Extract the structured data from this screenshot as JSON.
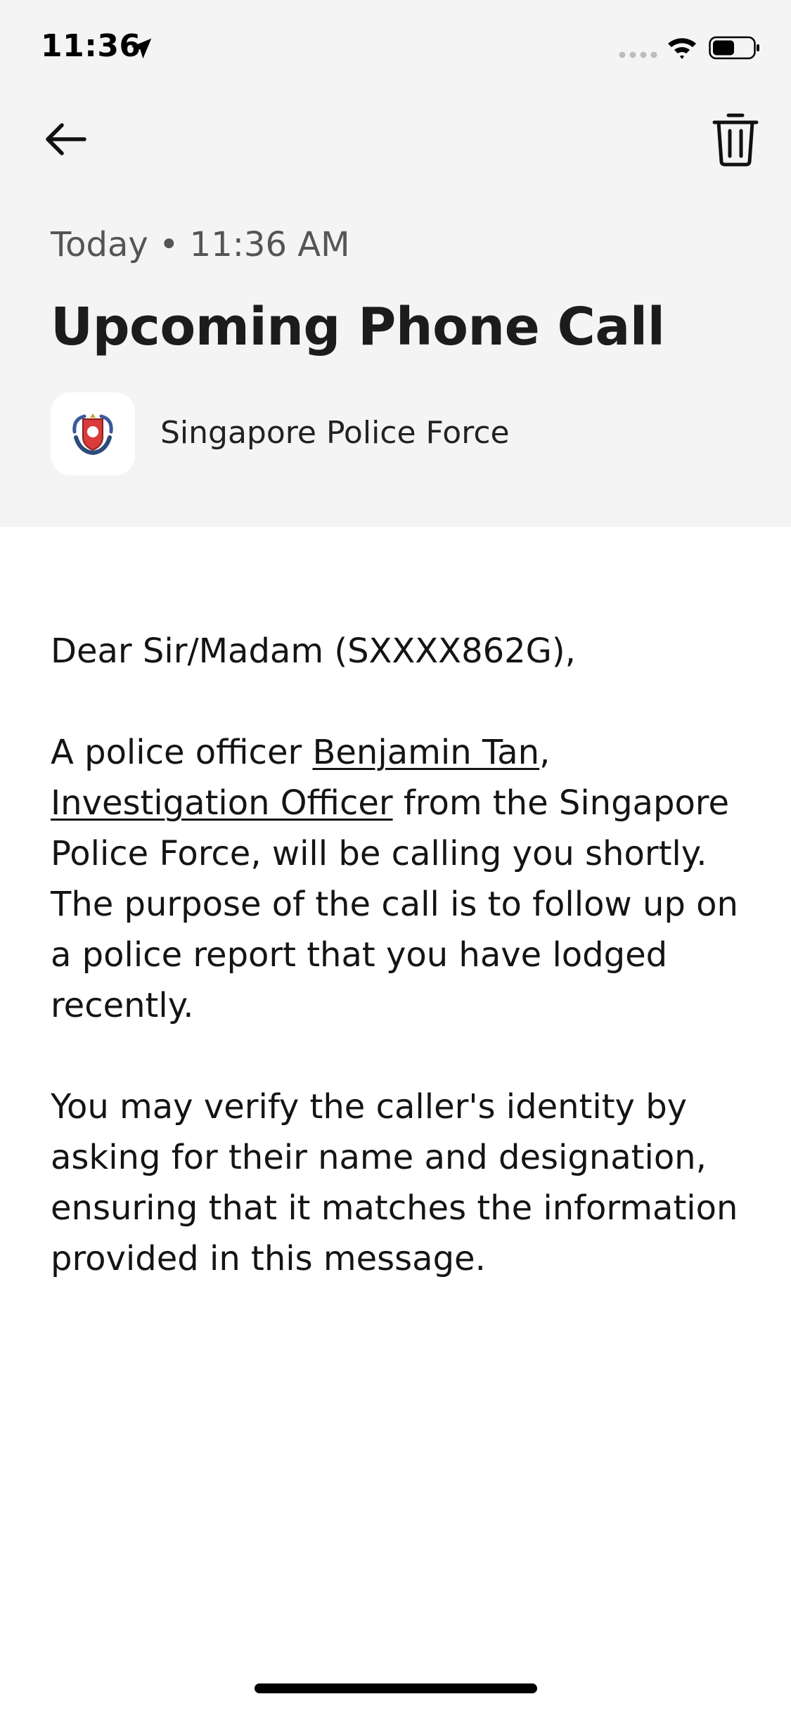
{
  "status_bar": {
    "time": "11:36"
  },
  "header": {
    "meta": "Today • 11:36 AM",
    "title": "Upcoming Phone Call",
    "sender_name": "Singapore Police Force"
  },
  "message": {
    "greeting": "Dear Sir/Madam (SXXXX862G),",
    "p1_prefix": "A police officer ",
    "officer_name": "Benjamin Tan",
    "p1_comma": ",",
    "officer_designation": "Investigation Officer",
    "p1_suffix": " from the Singapore Police Force, will be calling you shortly. The purpose of the call is to follow up on a police report that you have lodged recently.",
    "p2": "You may verify the caller's identity by asking for their name and designation, ensuring that it matches the information provided in this message."
  },
  "colors": {
    "header_bg": "#f4f4f4",
    "body_bg": "#ffffff",
    "text": "#1a1a1a",
    "meta_text": "#555555"
  },
  "icons": {
    "back": "arrow-left-icon",
    "delete": "trash-icon",
    "location": "location-arrow-icon",
    "signal": "cellular-signal-icon",
    "wifi": "wifi-icon",
    "battery": "battery-icon",
    "avatar": "police-crest-icon"
  }
}
